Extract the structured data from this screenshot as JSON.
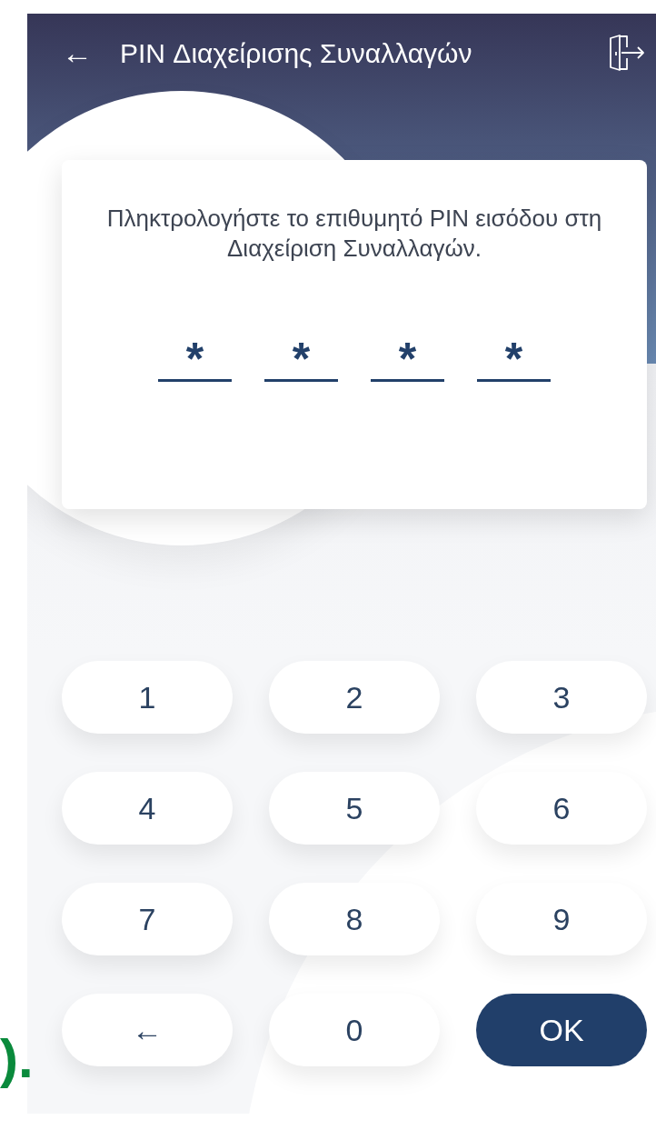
{
  "header": {
    "back": "←",
    "title": "PIN Διαχείρισης Συναλλαγών"
  },
  "card": {
    "instruction": "Πληκτρολογήστε το επιθυμητό PIN εισόδου στη Διαχείριση Συναλλαγών.",
    "pin_slots": [
      {
        "value": "*"
      },
      {
        "value": "*"
      },
      {
        "value": "*"
      },
      {
        "value": "*"
      }
    ]
  },
  "keypad": [
    {
      "kind": "digit",
      "label": "1"
    },
    {
      "kind": "digit",
      "label": "2"
    },
    {
      "kind": "digit",
      "label": "3"
    },
    {
      "kind": "digit",
      "label": "4"
    },
    {
      "kind": "digit",
      "label": "5"
    },
    {
      "kind": "digit",
      "label": "6"
    },
    {
      "kind": "digit",
      "label": "7"
    },
    {
      "kind": "digit",
      "label": "8"
    },
    {
      "kind": "digit",
      "label": "9"
    },
    {
      "kind": "back",
      "label": "←"
    },
    {
      "kind": "digit",
      "label": "0"
    },
    {
      "kind": "ok",
      "label": "OK"
    }
  ],
  "figure_label": ")."
}
